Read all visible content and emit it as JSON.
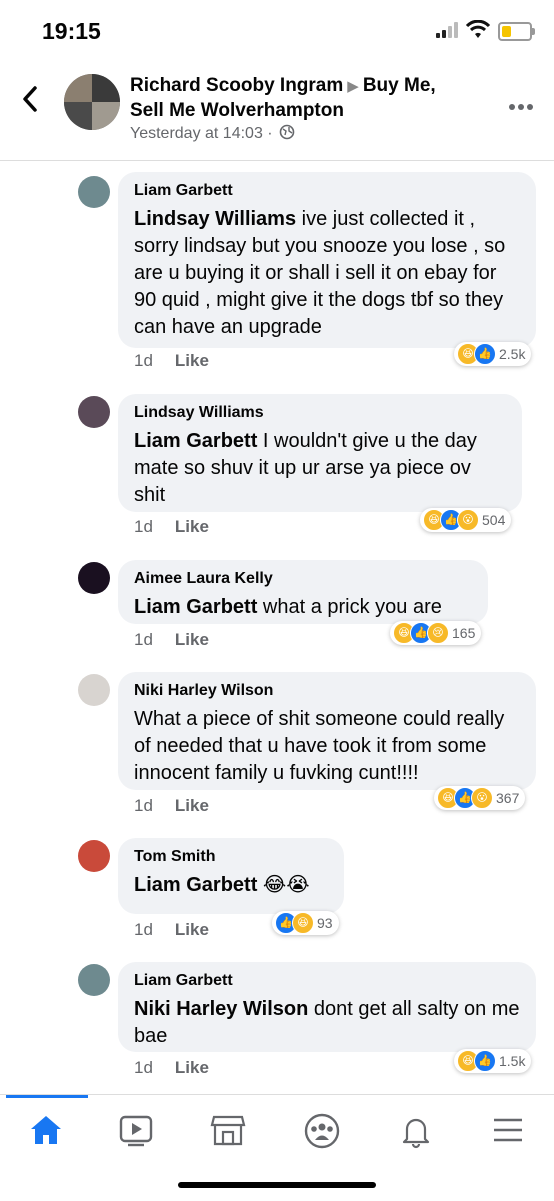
{
  "status": {
    "time": "19:15",
    "battery_level": 0.35
  },
  "header": {
    "poster": "Richard Scooby Ingram",
    "group": "Buy Me, Sell Me Wolverhampton",
    "timestamp": "Yesterday at 14:03 ·"
  },
  "comments": [
    {
      "author": "Liam Garbett",
      "mention": "Lindsay Williams",
      "text": " ive just collected it , sorry lindsay but you snooze you lose , so are u buying it or shall i sell it on ebay for 90 quid , might give it the dogs tbf so they can have an upgrade",
      "age": "1d",
      "like": "Like",
      "reactions": [
        "haha",
        "like"
      ],
      "count": "2.5k"
    },
    {
      "author": "Lindsay Williams",
      "mention": "Liam Garbett",
      "text": " I wouldn't give u the day mate so shuv it up ur arse ya piece ov shit",
      "age": "1d",
      "like": "Like",
      "reactions": [
        "haha",
        "like",
        "wow"
      ],
      "count": "504"
    },
    {
      "author": "Aimee Laura Kelly",
      "mention": "Liam Garbett",
      "text": "  what a prick you are",
      "age": "1d",
      "like": "Like",
      "reactions": [
        "haha",
        "like",
        "sad"
      ],
      "count": "165"
    },
    {
      "author": "Niki Harley Wilson",
      "mention": "",
      "text": "What a piece of shit someone could really of needed that u have took it from some innocent family u fuvking cunt!!!!",
      "age": "1d",
      "like": "Like",
      "reactions": [
        "haha",
        "like",
        "wow"
      ],
      "count": "367"
    },
    {
      "author": "Tom Smith",
      "mention": "Liam Garbett",
      "text": " 😂😭",
      "age": "1d",
      "like": "Like",
      "reactions": [
        "like",
        "haha"
      ],
      "count": "93"
    },
    {
      "author": "Liam Garbett",
      "mention": "Niki Harley Wilson",
      "text": "  dont get all salty on me bae",
      "age": "1d",
      "like": "Like",
      "reactions": [
        "haha",
        "like"
      ],
      "count": "1.5k"
    }
  ],
  "nav": [
    "home-icon",
    "watch-icon",
    "marketplace-icon",
    "groups-icon",
    "notifications-icon",
    "menu-icon"
  ]
}
